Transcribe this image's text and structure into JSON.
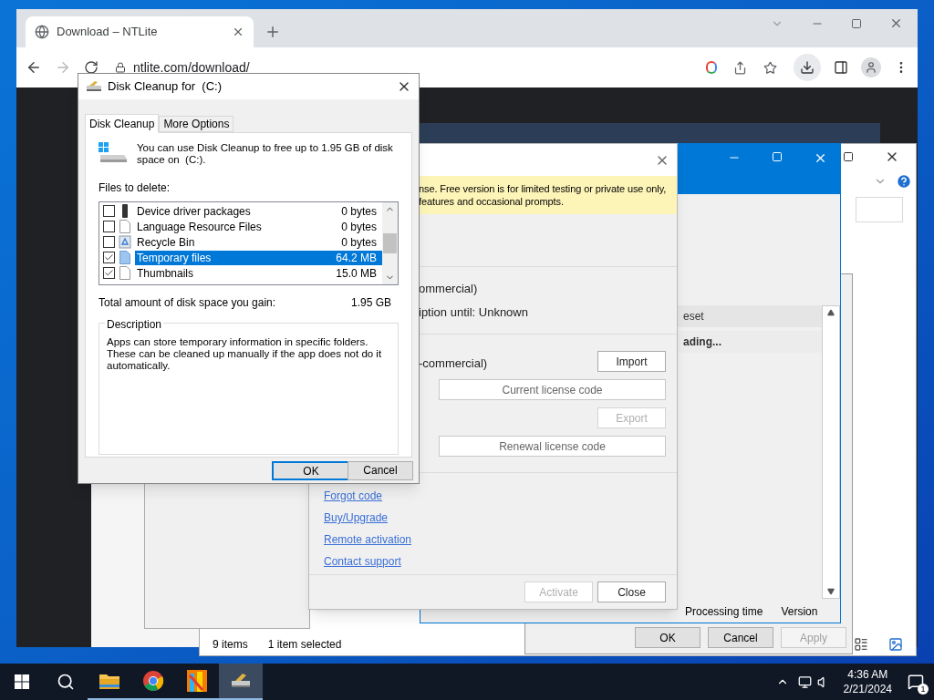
{
  "browser": {
    "tab_title": "Download – NTLite",
    "url": "ntlite.com/download/"
  },
  "explorer": {
    "status_count": "9 items",
    "status_selected": "1 item selected"
  },
  "properties": {
    "header_cell": "eset",
    "row_cell": "ading...",
    "columns": [
      "Processing time",
      "Version"
    ],
    "buttons": [
      {
        "label": "OK",
        "disabled": false
      },
      {
        "label": "Cancel",
        "disabled": false
      },
      {
        "label": "Apply",
        "disabled": true
      }
    ]
  },
  "license": {
    "banner": [
      "nse. Free version is for limited testing or private use only,",
      "features and occasional prompts."
    ],
    "info": [
      "ommercial)",
      "iption until: Unknown"
    ],
    "edition": "-commercial)",
    "actions": [
      {
        "label": "Import",
        "disabled": false,
        "kind": "small"
      },
      {
        "label": "Current license code",
        "disabled": false,
        "kind": "wide"
      },
      {
        "label": "Export",
        "disabled": true,
        "kind": "small"
      },
      {
        "label": "Renewal license code",
        "disabled": false,
        "kind": "wide"
      }
    ],
    "links": [
      "Forgot code",
      "Buy/Upgrade",
      "Remote activation",
      "Contact support"
    ],
    "buttons": [
      {
        "label": "Activate",
        "disabled": true
      },
      {
        "label": "Close",
        "disabled": false
      }
    ]
  },
  "disk_cleanup": {
    "title": "Disk Cleanup for  (C:)",
    "tabs": [
      {
        "label": "Disk Cleanup",
        "selected": true
      },
      {
        "label": "More Options",
        "selected": false
      }
    ],
    "intro": "You can use Disk Cleanup to free up to 1.95 GB of disk space on  (C:).",
    "files_label": "Files to delete:",
    "items": [
      {
        "name": "Device driver packages",
        "size": "0 bytes",
        "checked": false,
        "selected": false,
        "kind": "driver"
      },
      {
        "name": "Language Resource Files",
        "size": "0 bytes",
        "checked": false,
        "selected": false,
        "kind": "file"
      },
      {
        "name": "Recycle Bin",
        "size": "0 bytes",
        "checked": false,
        "selected": false,
        "kind": "recycle"
      },
      {
        "name": "Temporary files",
        "size": "64.2 MB",
        "checked": true,
        "selected": true,
        "kind": "file-blue"
      },
      {
        "name": "Thumbnails",
        "size": "15.0 MB",
        "checked": true,
        "selected": false,
        "kind": "file"
      }
    ],
    "total_label": "Total amount of disk space you gain:",
    "total_value": "1.95 GB",
    "description_title": "Description",
    "description": "Apps can store temporary information in specific folders. These can be cleaned up manually if the app does not do it automatically.",
    "buttons": [
      {
        "label": "OK",
        "default": true
      },
      {
        "label": "Cancel",
        "default": false
      }
    ]
  },
  "taskbar": {
    "apps": [
      {
        "kind": "explorer",
        "active": false
      },
      {
        "kind": "chrome",
        "active": false
      },
      {
        "kind": "ntlite",
        "active": false
      },
      {
        "kind": "cleanup",
        "active": true
      }
    ],
    "time": "4:36 AM",
    "date": "2/21/2024",
    "notifications": "1"
  }
}
